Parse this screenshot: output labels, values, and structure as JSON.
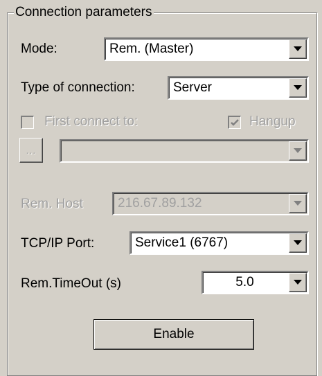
{
  "group": {
    "title": "Connection parameters"
  },
  "mode": {
    "label": "Mode:",
    "value": "Rem. (Master)"
  },
  "connection_type": {
    "label": "Type of connection:",
    "value": "Server"
  },
  "first_connect": {
    "label": "First connect to:",
    "checked": false,
    "enabled": false
  },
  "hangup": {
    "label": "Hangup",
    "checked": true,
    "enabled": false
  },
  "browse_button": {
    "label": "..."
  },
  "first_connect_combo": {
    "value": ""
  },
  "rem_host": {
    "label": "Rem. Host",
    "value": "216.67.89.132"
  },
  "tcp_port": {
    "label": "TCP/IP Port:",
    "value": "Service1 (6767)"
  },
  "rem_timeout": {
    "label": "Rem.TimeOut (s)",
    "value": "5.0"
  },
  "enable_button": {
    "label": "Enable"
  }
}
